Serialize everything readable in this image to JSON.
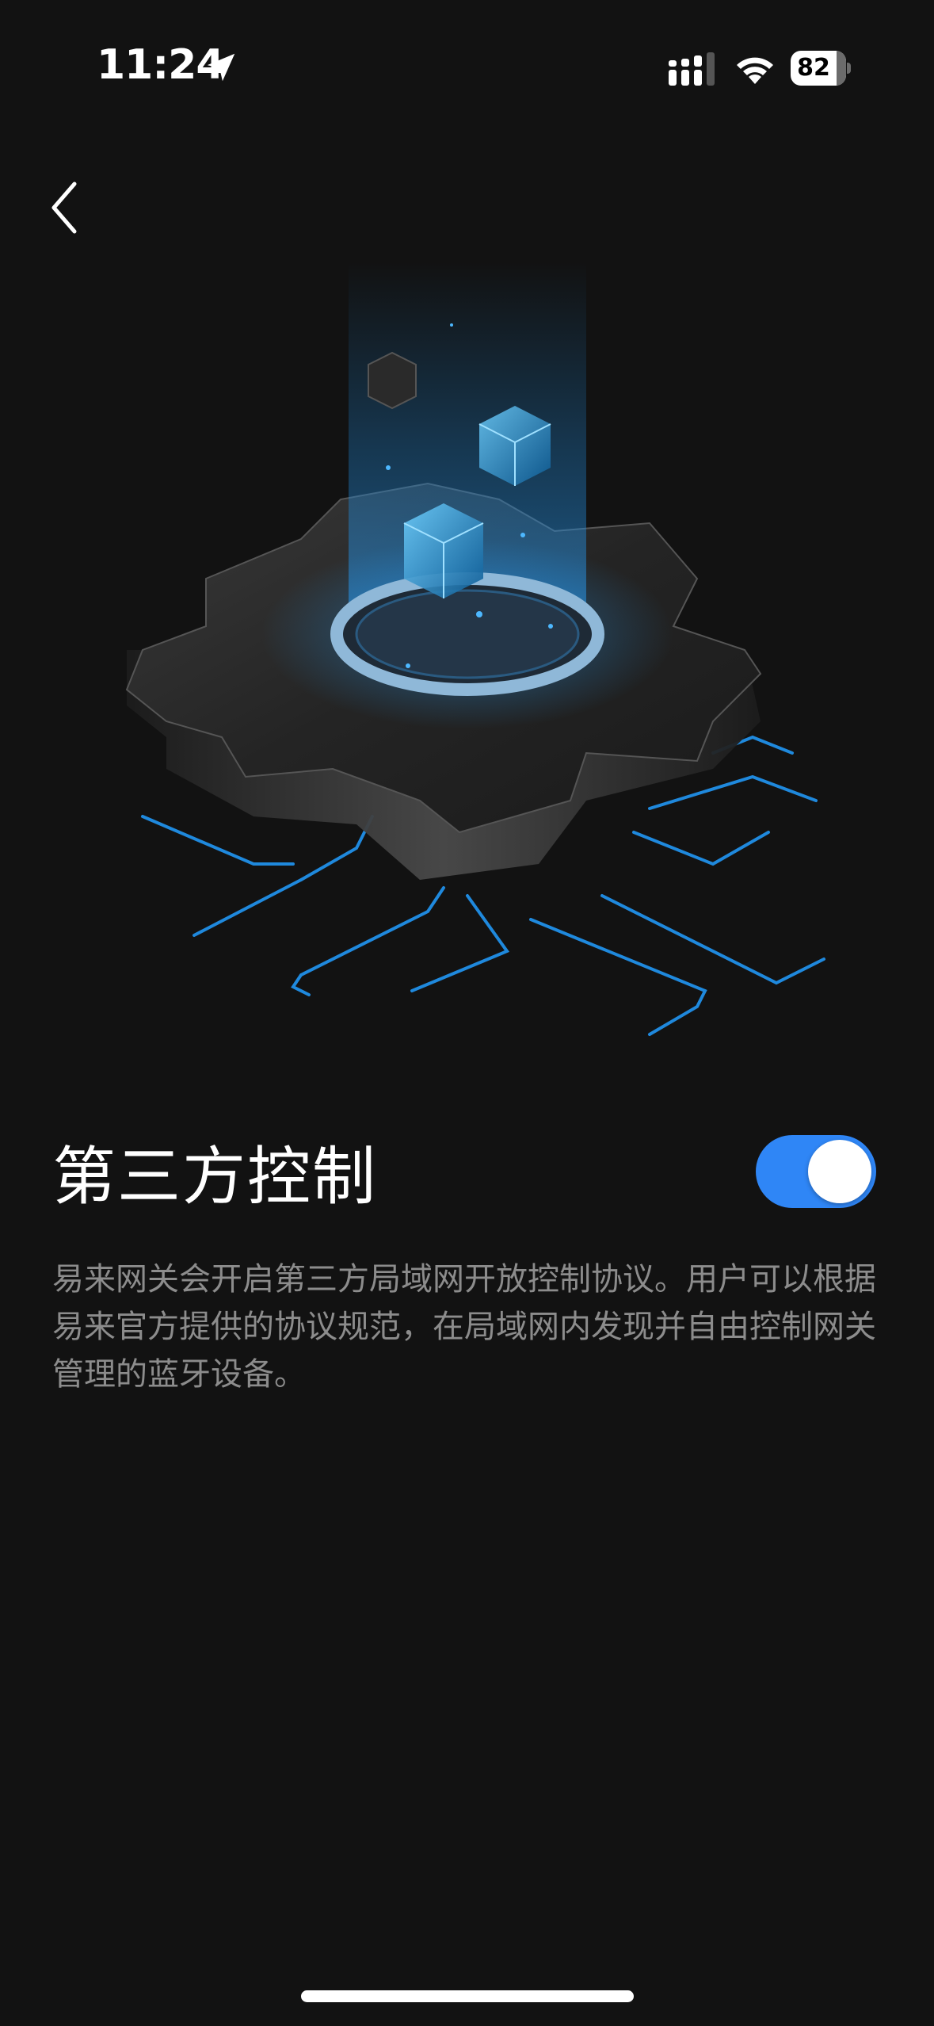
{
  "status_bar": {
    "time": "11:24",
    "battery_level": "82",
    "icons": [
      "location-arrow-icon",
      "cellular-signal-icon",
      "wifi-icon",
      "battery-icon"
    ]
  },
  "nav": {
    "back_icon": "chevron-left-icon"
  },
  "hero": {
    "illustration": "gear-platform-with-glowing-cubes",
    "accent_color": "#2aa3ff"
  },
  "setting": {
    "title": "第三方控制",
    "enabled": true,
    "toggle_color": "#2f86f6",
    "description": "易来网关会开启第三方局域网开放控制协议。用户可以根据易来官方提供的协议规范，在局域网内发现并自由控制网关管理的蓝牙设备。"
  }
}
